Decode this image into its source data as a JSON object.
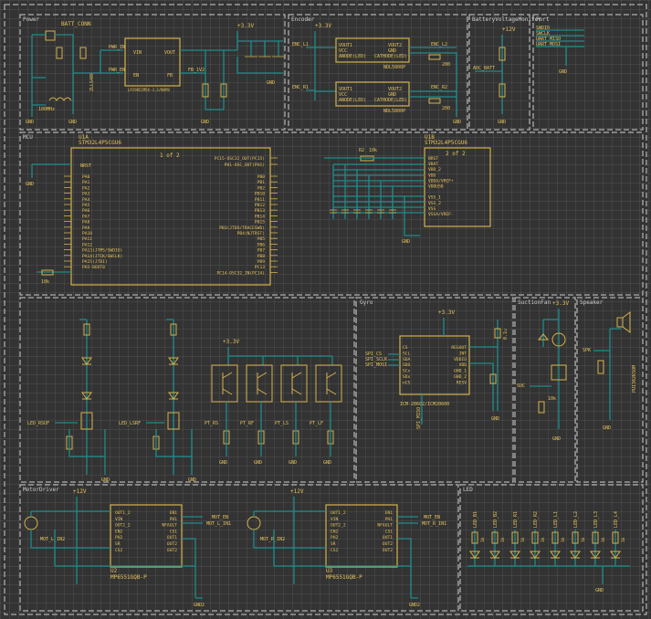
{
  "sections": {
    "power": "Power",
    "encoder": "Encoder",
    "battery": "BatteryVoltageMonitor",
    "port": "Port",
    "mcu": "MCU",
    "gyro": "Gyro",
    "suction": "SuctionFan",
    "speaker": "Speaker",
    "motor": "MotorDriver",
    "led": "LED"
  },
  "power": {
    "batt_conn": "BATT_CONN",
    "diode": "ZLLS400",
    "res_100mhz": "100MHz",
    "regulator": "LP2985IM5X-3.3/NOPB",
    "pin_vin": "VIN",
    "pin_vout": "VOUT",
    "pin_en": "EN",
    "pin_fb": "FB",
    "pwr_in": "PWR_IN",
    "pwr_en": "PWR_EN",
    "fb_label": "FB_1V2",
    "gnd": "GND"
  },
  "encoder": {
    "ic1": "NDL5800P",
    "ic2": "NDL5800P",
    "pins_left": [
      "VOUT1",
      "VCC",
      "ANODE(LED)"
    ],
    "pins_right": [
      "VOUT2",
      "GND",
      "CATHODE(LED)"
    ],
    "enc_l1": "ENC_L1",
    "enc_l2": "ENC_L2",
    "enc_r1": "ENC_R1",
    "enc_r2": "ENC_R2",
    "res": "200"
  },
  "battery": {
    "adc": "ADC_BATT",
    "vcc": "+12V"
  },
  "port": {
    "nets": [
      "SWDIO",
      "SWCLK",
      "UART_MISO",
      "UART_MOSI"
    ]
  },
  "mcu": {
    "u1a": "U1A",
    "u1a_part": "STM32L4P5CGU6",
    "u1a_page": "1 of 2",
    "u1b": "U1B",
    "u1b_part": "STM32L4P5CGU6",
    "u1b_page": "2 of 2",
    "left_pins": [
      "PA0",
      "PA1",
      "PA2",
      "PA3",
      "PA4",
      "PA5",
      "PA6",
      "PA7",
      "PA8",
      "PA9",
      "PA10",
      "PA11",
      "PA12",
      "PA13(JTMS/SWDIO)",
      "PA14(JTCK/SWCLK)",
      "PA15(JTDI)",
      "PH3-BOOT0"
    ],
    "right_pins": [
      "PC15-OSC32_OUT(PC15)",
      "PH1-OSC_OUT(PH1)",
      "PB0",
      "PB1",
      "PB2",
      "PB10",
      "PB11",
      "PB12",
      "PB13",
      "PB14",
      "PB15",
      "PB3(JTDO/TRACESWO)",
      "PB4(NJTRST)",
      "PB5",
      "PB6",
      "PB7",
      "PB8",
      "PB9",
      "PC13",
      "PC14-OSC32_IN(PC14)"
    ],
    "nrst": "NRST",
    "u1b_pins": [
      "NRST",
      "VBAT",
      "VDD_2",
      "VDD",
      "VDDA/VREF+",
      "VDDUSB",
      "",
      "VSS_1",
      "VSS_2",
      "VSS",
      "VSSA/VREF-"
    ],
    "res_10k": "10k",
    "r_label": "R2"
  },
  "gyro": {
    "part": "ICM-20602/ICM20600",
    "pins_left": [
      "CS",
      "SCL",
      "SDA",
      "SDO",
      "SCx",
      "SDx",
      "nCS"
    ],
    "pins_right": [
      "REGOUT",
      "INT",
      "VDDIO",
      "VDD",
      "GND_1",
      "GND_2",
      "RESV"
    ],
    "spi_cs": "SPI_CS",
    "spi_sclk": "SPI_SCLK",
    "spi_mosi": "SPI_MOSI",
    "spi_miso": "SPI_MISO",
    "cap": "0.1u"
  },
  "sensors": {
    "led_rsut": "LED_RSUF",
    "led_lsrf": "LED_LSRF",
    "pt_rs": "PT_RS",
    "pt_rf": "PT_RF",
    "pt_ls": "PT_LS",
    "pt_lf": "PT_LF",
    "vcc": "+3.3V"
  },
  "suction": {
    "net": "SUC",
    "res": "10k"
  },
  "speaker": {
    "net": "SPK",
    "part": "PUI302KSOM"
  },
  "motor": {
    "u2": "U2",
    "u2_part": "MP6551GQB-P",
    "u3": "U3",
    "u3_part": "MP6551GQB-P",
    "pins_left": [
      "OUT1_2",
      "VIN",
      "OUT2_2",
      "EN2",
      "PH2",
      "SR",
      "CS2"
    ],
    "pins_right": [
      "EN1",
      "PH1",
      "NFAULT",
      "CS1",
      "OUT1",
      "OUT2",
      "OUT2"
    ],
    "mot_en": "MOT_EN",
    "mot_l_in1": "MOT_L_IN1",
    "mot_l_in2": "MOT_L_IN2",
    "mot_r_in1": "MOT_R_IN1",
    "mot_r_in2": "MOT_R_IN2",
    "vcc": "+12V",
    "gnd": "GND2"
  },
  "leds": {
    "labels": [
      "LED_B1",
      "LED_B2",
      "LED_R1",
      "LED_R2",
      "LED_L1",
      "LED_L2",
      "LED_L3",
      "LED_L4"
    ],
    "res": "1k"
  },
  "common": {
    "gnd": "GND",
    "v33": "+3.3V",
    "v12": "+12V"
  },
  "colors": {
    "wire": "#1e8c8c",
    "symbol": "#d4b24c",
    "frame": "#cfcfcf",
    "background": "#333333"
  }
}
